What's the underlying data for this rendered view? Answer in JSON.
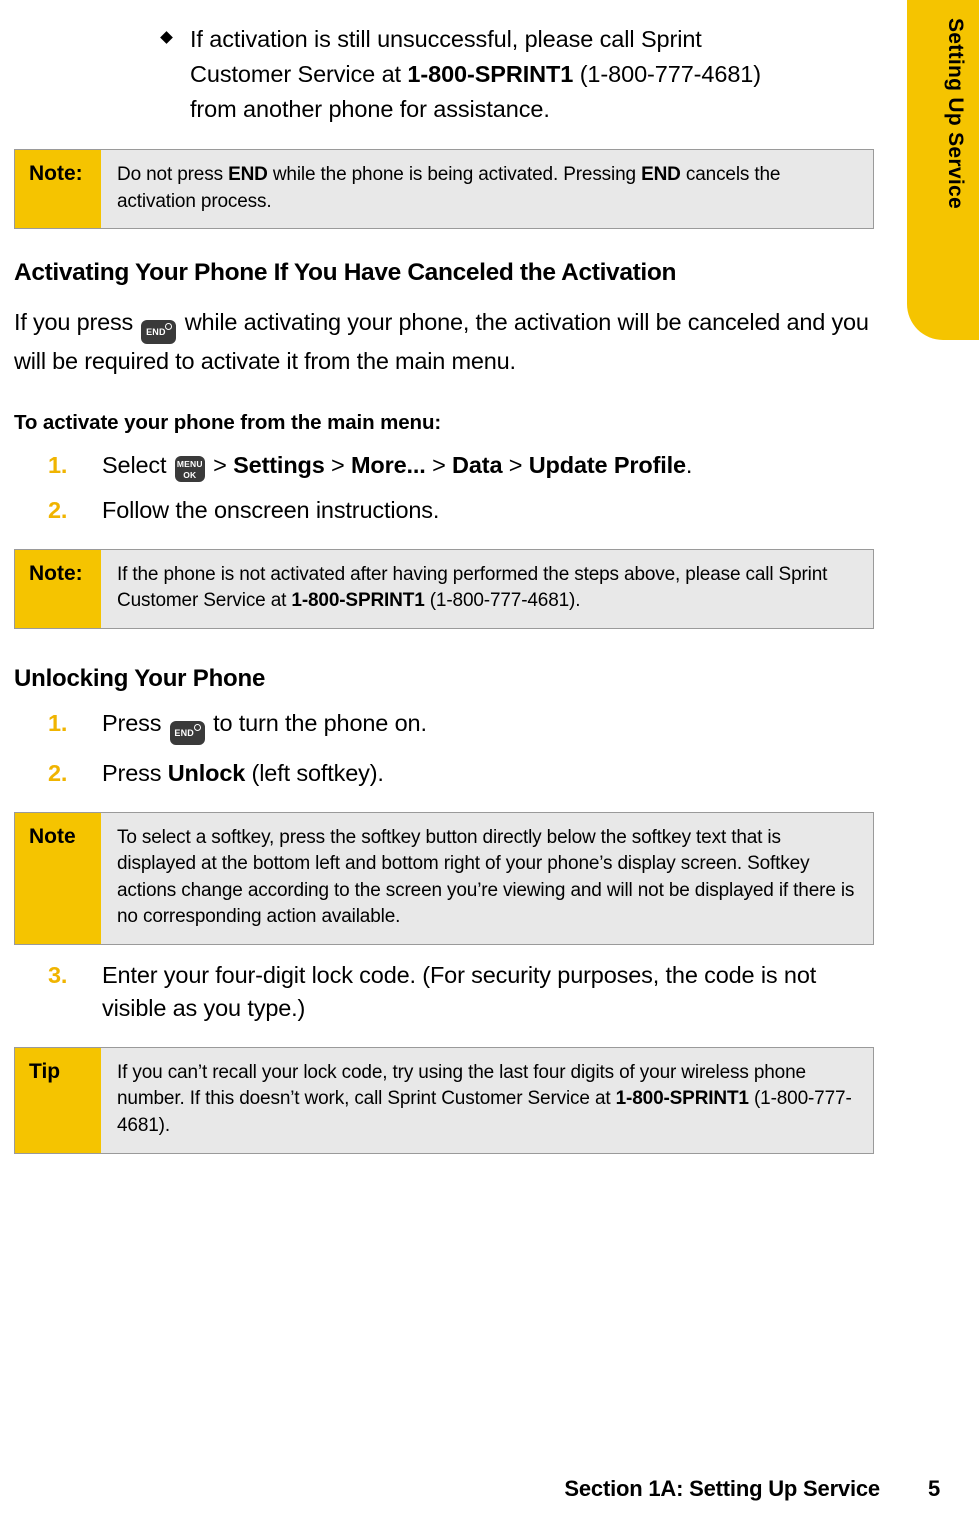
{
  "side_tab": {
    "label": "Setting Up Service",
    "bg_color": "#f5c400"
  },
  "bullet": {
    "part1": "If activation is still unsuccessful, please call Sprint Customer Service at ",
    "bold1": "1-800-SPRINT1",
    "part2": " (1-800-777-4681) from another phone for assistance."
  },
  "note1": {
    "label": "Note:",
    "part1": "Do not press ",
    "bold1": "END",
    "part2": " while the phone is being activated. Pressing ",
    "bold2": "END",
    "part3": " cancels the activation process."
  },
  "section_heading": "Activating Your Phone If You Have Canceled the Activation",
  "paragraph1": {
    "part1": "If you press ",
    "key": "END",
    "part2": " while activating your phone, the activation will be canceled and you will be required to activate it from the main menu."
  },
  "lead_in": "To activate your phone from the main menu:",
  "steps1": [
    {
      "num": "1.",
      "part1": "Select ",
      "key": "MENU OK",
      "part2": " > ",
      "bold1": "Settings",
      "part3": " > ",
      "bold2": "More...",
      "part4": " > ",
      "bold3": "Data",
      "part5": " > ",
      "bold4": "Update Profile",
      "part6": "."
    },
    {
      "num": "2.",
      "text": "Follow the onscreen instructions."
    }
  ],
  "note2": {
    "label": "Note:",
    "part1": "If the phone is not activated after having performed the steps above, please call Sprint Customer Service at ",
    "bold1": "1-800-SPRINT1",
    "part2": " (1-800-777-4681)."
  },
  "sub_heading": "Unlocking Your Phone",
  "steps2": [
    {
      "num": "1.",
      "part1": "Press ",
      "key": "END",
      "part2": " to turn the phone on."
    },
    {
      "num": "2.",
      "part1": "Press ",
      "bold1": "Unlock",
      "part2": " (left softkey)."
    }
  ],
  "note3": {
    "label": "Note",
    "text": "To select a softkey, press the softkey button directly below the softkey text that is displayed at the bottom left and bottom right of your phone’s display screen. Softkey actions change according to the screen you’re viewing and will not be displayed if there is no corresponding action available."
  },
  "step3": {
    "num": "3.",
    "text": "Enter your four-digit lock code. (For security purposes, the code is not visible as you type.)"
  },
  "tip": {
    "label": "Tip",
    "part1": "If you can’t recall your lock code, try using the last four digits of your wireless phone number. If this doesn’t work, call Sprint Customer Service at ",
    "bold1": "1-800-SPRINT1",
    "part2": " (1-800-777-4681)."
  },
  "footer": {
    "section": "Section 1A: Setting Up Service",
    "page": "5"
  }
}
